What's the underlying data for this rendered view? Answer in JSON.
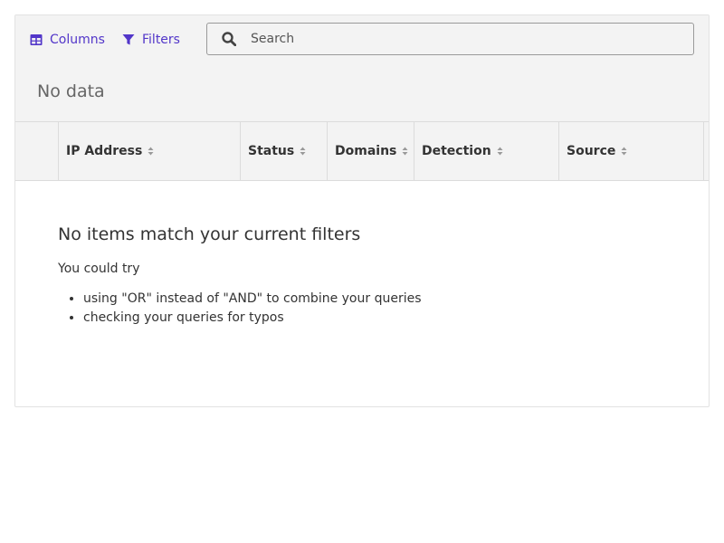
{
  "toolbar": {
    "columns_label": "Columns",
    "filters_label": "Filters",
    "search_placeholder": "Search",
    "search_value": ""
  },
  "no_data_label": "No data",
  "table": {
    "columns": [
      "",
      "IP Address",
      "Status",
      "Domains",
      "Detection",
      "Source",
      ""
    ]
  },
  "empty_state": {
    "title": "No items match your current filters",
    "subtitle": "You could try",
    "suggestions": [
      "using \"OR\" instead of \"AND\" to combine your queries",
      "checking your queries for typos"
    ]
  },
  "icons": {
    "columns": "table-grid-icon",
    "filters": "funnel-icon",
    "search": "magnifier-icon",
    "sort": "sort-caret-icon"
  },
  "colors": {
    "accent": "#5236c9",
    "toolbar_bg": "#f3f3f3",
    "border": "#dcdcdc",
    "text": "#333333"
  }
}
